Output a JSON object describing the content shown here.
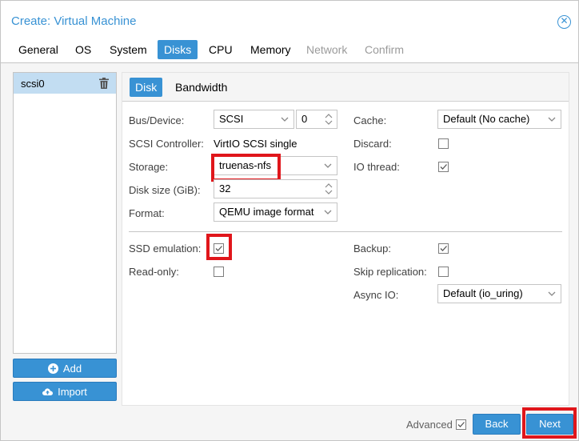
{
  "window": {
    "title": "Create: Virtual Machine"
  },
  "tabs": [
    {
      "label": "General",
      "state": "normal"
    },
    {
      "label": "OS",
      "state": "normal"
    },
    {
      "label": "System",
      "state": "normal"
    },
    {
      "label": "Disks",
      "state": "active"
    },
    {
      "label": "CPU",
      "state": "normal"
    },
    {
      "label": "Memory",
      "state": "normal"
    },
    {
      "label": "Network",
      "state": "disabled"
    },
    {
      "label": "Confirm",
      "state": "disabled"
    }
  ],
  "disk_list": {
    "items": [
      {
        "label": "scsi0"
      }
    ]
  },
  "side_buttons": {
    "add": "Add",
    "import": "Import"
  },
  "subtabs": {
    "disk": "Disk",
    "bandwidth": "Bandwidth"
  },
  "form": {
    "bus_device": {
      "label": "Bus/Device:",
      "bus": "SCSI",
      "device": "0"
    },
    "scsi_controller": {
      "label": "SCSI Controller:",
      "value": "VirtIO SCSI single"
    },
    "storage": {
      "label": "Storage:",
      "value": "truenas-nfs"
    },
    "disk_size": {
      "label": "Disk size (GiB):",
      "value": "32"
    },
    "format": {
      "label": "Format:",
      "value": "QEMU image format"
    },
    "cache": {
      "label": "Cache:",
      "value": "Default (No cache)"
    },
    "discard": {
      "label": "Discard:",
      "checked": false
    },
    "io_thread": {
      "label": "IO thread:",
      "checked": true
    },
    "ssd_emulation": {
      "label": "SSD emulation:",
      "checked": true
    },
    "read_only": {
      "label": "Read-only:",
      "checked": false
    },
    "backup": {
      "label": "Backup:",
      "checked": true
    },
    "skip_replication": {
      "label": "Skip replication:",
      "checked": false
    },
    "async_io": {
      "label": "Async IO:",
      "value": "Default (io_uring)"
    }
  },
  "footer": {
    "advanced_label": "Advanced",
    "advanced_checked": true,
    "back": "Back",
    "next": "Next"
  },
  "colors": {
    "accent": "#3892d4",
    "highlight": "#e0161b",
    "selected_row": "#c2ddf2"
  }
}
